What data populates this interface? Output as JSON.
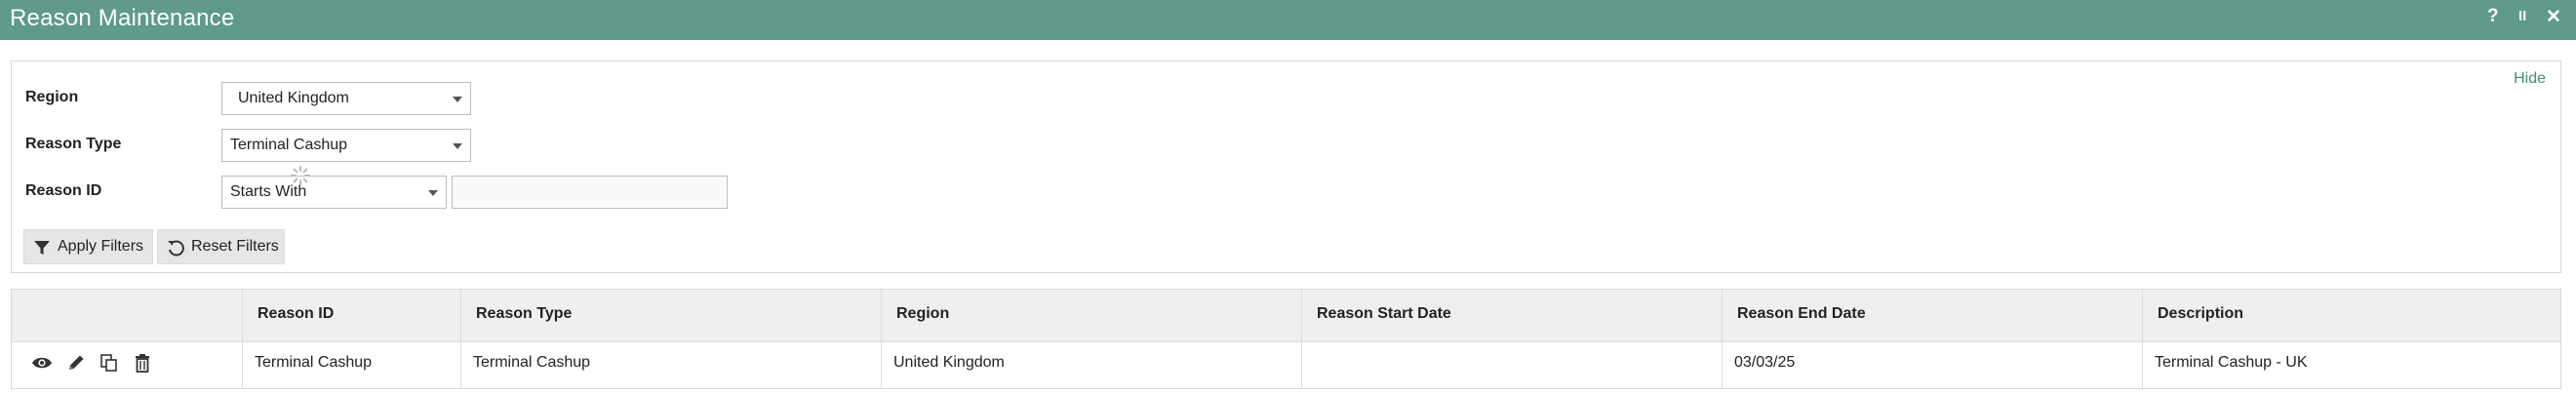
{
  "window": {
    "title": "Reason Maintenance",
    "help_label": "?",
    "pause_label": "II",
    "close_label": "✕"
  },
  "filters": {
    "hide_label": "Hide",
    "region_label": "Region",
    "region_value": "United Kingdom",
    "reason_type_label": "Reason Type",
    "reason_type_value": "Terminal Cashup",
    "reason_id_label": "Reason ID",
    "reason_id_operator": "Starts With",
    "reason_id_value": "",
    "apply_label": "Apply Filters",
    "reset_label": "Reset Filters"
  },
  "table": {
    "columns": [
      "Reason ID",
      "Reason Type",
      "Region",
      "Reason Start Date",
      "Reason End Date",
      "Description"
    ],
    "rows": [
      {
        "actions": [
          "view-icon",
          "edit-icon",
          "copy-icon",
          "delete-icon"
        ],
        "cells": [
          "Terminal Cashup",
          "Terminal Cashup",
          "United Kingdom",
          "",
          "03/03/25",
          "Terminal Cashup - UK"
        ]
      }
    ]
  }
}
